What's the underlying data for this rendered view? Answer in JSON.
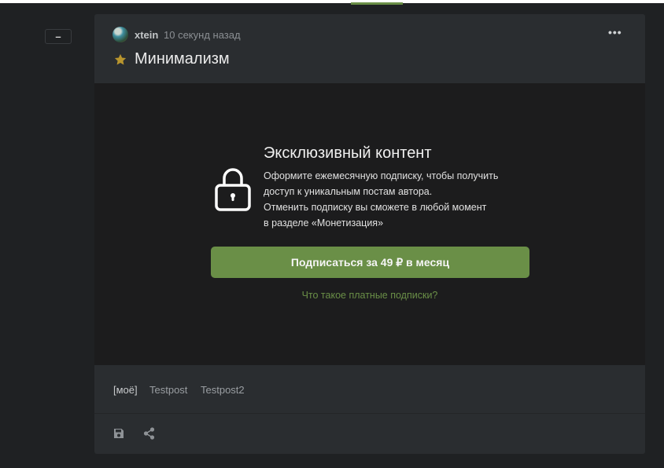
{
  "post": {
    "author": "xtein",
    "time": "10 секунд назад",
    "title": "Минимализм",
    "more_label": "•••"
  },
  "collapse": {
    "label": "–"
  },
  "exclusive": {
    "title": "Эксклюзивный контент",
    "lines": [
      "Оформите ежемесячную подписку, чтобы получить",
      "доступ к уникальным постам автора.",
      "Отменить подписку вы сможете в любой момент",
      "в разделе «Монетизация»"
    ],
    "subscribe_label": "Подписаться за 49 ₽ в месяц",
    "what_link": "Что такое платные подписки?"
  },
  "tags": [
    "[моё]",
    "Testpost",
    "Testpost2"
  ],
  "icons": {
    "lock": "lock-icon",
    "star": "star-icon",
    "save": "save-icon",
    "share": "share-icon",
    "more": "more-icon"
  },
  "colors": {
    "accent": "#6a8f47",
    "star": "#b8952e",
    "background": "#1f2123",
    "card": "#2a2d30",
    "locked_area": "#1c1c1d"
  }
}
